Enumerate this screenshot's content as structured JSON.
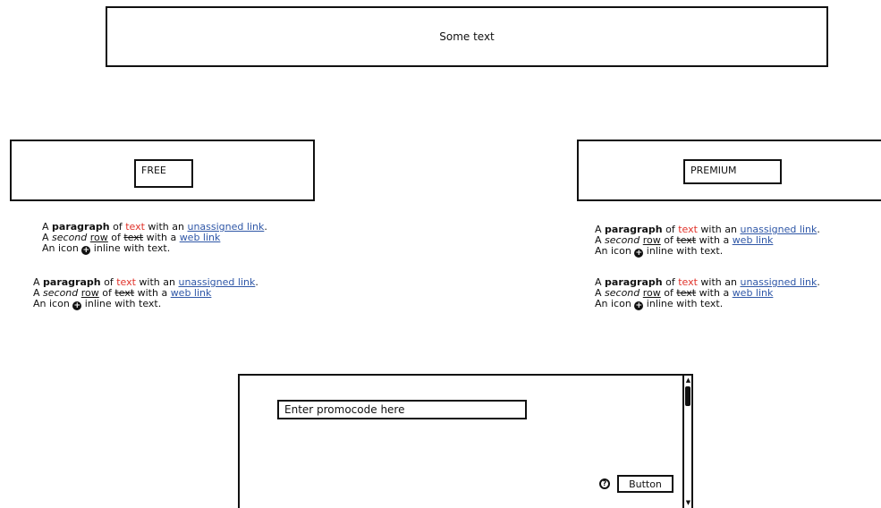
{
  "banner": {
    "text": "Some text"
  },
  "free": {
    "label": "FREE"
  },
  "premium": {
    "label": "PREMIUM"
  },
  "paragraph_block": {
    "l1_a": "A ",
    "l1_bold": "paragraph",
    "l1_b": " of ",
    "l1_red": "text",
    "l1_c": " with an ",
    "l1_link": "unassigned link",
    "l1_d": ".",
    "l2_a": "A ",
    "l2_italic": "second",
    "l2_b": " ",
    "l2_underline": "row",
    "l2_c": " of ",
    "l2_strike": "text",
    "l2_d": " with a ",
    "l2_link": "web link",
    "l3_a": "An icon ",
    "l3_icon": "+",
    "l3_b": " inline with text."
  },
  "promo": {
    "placeholder": "Enter promocode here",
    "help_glyph": "?",
    "button_label": "Button",
    "scroll_up_glyph": "▲",
    "scroll_down_glyph": "▼"
  }
}
